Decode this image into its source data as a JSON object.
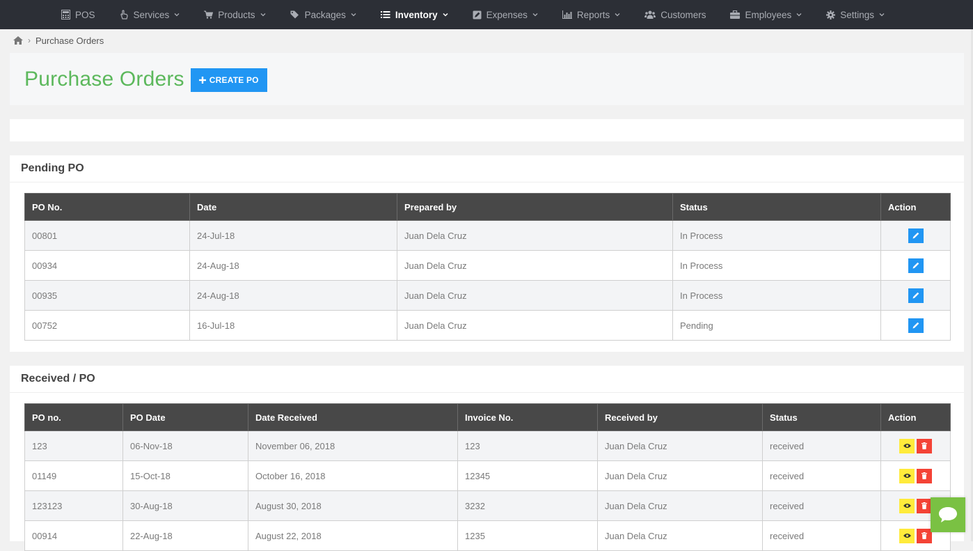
{
  "nav": {
    "items": [
      {
        "label": "POS",
        "icon": "calculator-icon",
        "dropdown": false
      },
      {
        "label": "Services",
        "icon": "hand-icon",
        "dropdown": true
      },
      {
        "label": "Products",
        "icon": "cart-icon",
        "dropdown": true
      },
      {
        "label": "Packages",
        "icon": "tags-icon",
        "dropdown": true
      },
      {
        "label": "Inventory",
        "icon": "list-icon",
        "dropdown": true
      },
      {
        "label": "Expenses",
        "icon": "edit-square-icon",
        "dropdown": true
      },
      {
        "label": "Reports",
        "icon": "bar-chart-icon",
        "dropdown": true
      },
      {
        "label": "Customers",
        "icon": "users-icon",
        "dropdown": false
      },
      {
        "label": "Employees",
        "icon": "briefcase-icon",
        "dropdown": true
      },
      {
        "label": "Settings",
        "icon": "gear-icon",
        "dropdown": true
      }
    ],
    "active": "Inventory"
  },
  "breadcrumb": {
    "current": "Purchase Orders"
  },
  "header": {
    "title": "Purchase Orders",
    "create_label": "CREATE PO"
  },
  "pending": {
    "title": "Pending PO",
    "columns": [
      "PO No.",
      "Date",
      "Prepared by",
      "Status",
      "Action"
    ],
    "rows": [
      {
        "po": "00801",
        "date": "24-Jul-18",
        "prepared_by": "Juan Dela Cruz",
        "status": "In Process"
      },
      {
        "po": "00934",
        "date": "24-Aug-18",
        "prepared_by": "Juan Dela Cruz",
        "status": "In Process"
      },
      {
        "po": "00935",
        "date": "24-Aug-18",
        "prepared_by": "Juan Dela Cruz",
        "status": "In Process"
      },
      {
        "po": "00752",
        "date": "16-Jul-18",
        "prepared_by": "Juan Dela Cruz",
        "status": "Pending"
      }
    ]
  },
  "received": {
    "title": "Received / PO",
    "columns": [
      "PO no.",
      "PO Date",
      "Date Received",
      "Invoice No.",
      "Received by",
      "Status",
      "Action"
    ],
    "rows": [
      {
        "po": "123",
        "po_date": "06-Nov-18",
        "date_received": "November 06, 2018",
        "invoice": "123",
        "received_by": "Juan Dela Cruz",
        "status": "received"
      },
      {
        "po": "01149",
        "po_date": "15-Oct-18",
        "date_received": "October 16, 2018",
        "invoice": "12345",
        "received_by": "Juan Dela Cruz",
        "status": "received"
      },
      {
        "po": "123123",
        "po_date": "30-Aug-18",
        "date_received": "August 30, 2018",
        "invoice": "3232",
        "received_by": "Juan Dela Cruz",
        "status": "received"
      },
      {
        "po": "00914",
        "po_date": "22-Aug-18",
        "date_received": "August 22, 2018",
        "invoice": "1235",
        "received_by": "Juan Dela Cruz",
        "status": "received"
      }
    ]
  },
  "colors": {
    "nav_bg": "#2c2f36",
    "title_green": "#5cb85c",
    "primary_blue": "#2196f3",
    "header_dark": "#484848",
    "view_yellow": "#ffeb3b",
    "delete_red": "#f44336",
    "chat_green": "#7ac143"
  }
}
